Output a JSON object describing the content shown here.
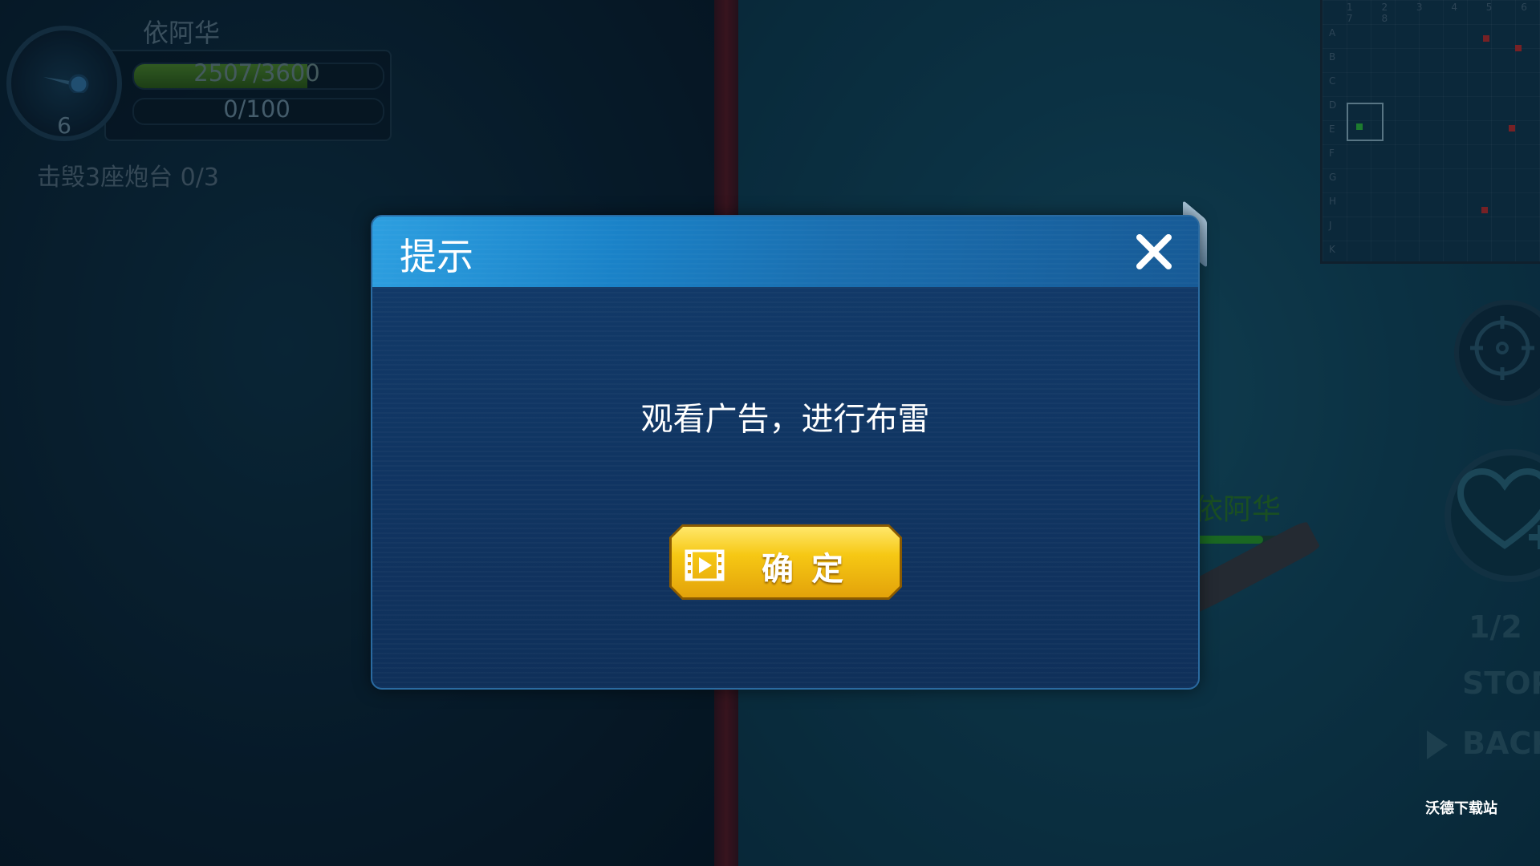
{
  "hud": {
    "ship_name": "依阿华",
    "level": "6",
    "hp_text": "2507/3600",
    "hp_fraction": 0.6964,
    "special_text": "0/100",
    "special_fraction": 0,
    "objective": "击毁3座炮台 0/3"
  },
  "minimap": {
    "columns": "1 2 3 4 5 6 7 8",
    "rows": [
      "A",
      "B",
      "C",
      "D",
      "E",
      "F",
      "G",
      "H",
      "J",
      "K"
    ]
  },
  "world": {
    "enemy_ship_name": "依阿华",
    "enemy_hp_fraction": 0.82
  },
  "controls": {
    "speed": "1/2",
    "stop": "STOP",
    "back": "BACK"
  },
  "dialog": {
    "title": "提示",
    "message": "观看广告，进行布雷",
    "confirm_label": "确定",
    "icons": {
      "close": "close-icon",
      "video": "video-ad-icon"
    }
  },
  "watermark": "沃德下载站",
  "colors": {
    "dialog_header": "#1a82c8",
    "dialog_body": "#123b6a",
    "confirm_button": "#f6c814",
    "hp_green": "#4f8a2a"
  }
}
